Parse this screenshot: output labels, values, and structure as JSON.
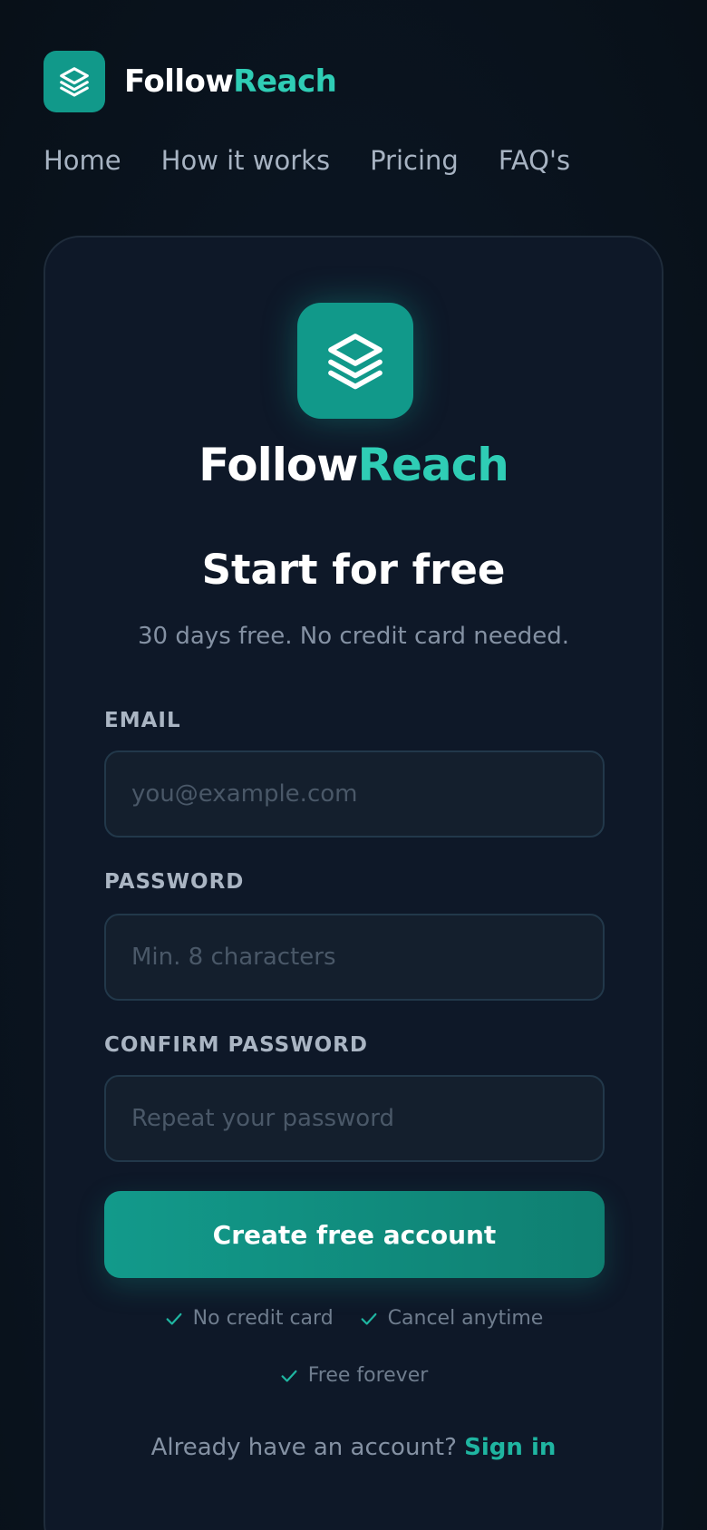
{
  "header": {
    "brand_part1": "Follow",
    "brand_part2": "Reach"
  },
  "nav": {
    "items": [
      {
        "label": "Home"
      },
      {
        "label": "How it works"
      },
      {
        "label": "Pricing"
      },
      {
        "label": "FAQ's"
      }
    ]
  },
  "card": {
    "brand_part1": "Follow",
    "brand_part2": "Reach",
    "title": "Start for free",
    "subtitle": "30 days free. No credit card needed."
  },
  "form": {
    "email_label": "EMAIL",
    "email_placeholder": "you@example.com",
    "email_value": "",
    "password_label": "PASSWORD",
    "password_placeholder": "Min. 8 characters",
    "password_value": "",
    "confirm_label": "CONFIRM PASSWORD",
    "confirm_placeholder": "Repeat your password",
    "confirm_value": "",
    "submit_label": "Create free account"
  },
  "perks": [
    {
      "label": "No credit card"
    },
    {
      "label": "Cancel anytime"
    },
    {
      "label": "Free forever"
    }
  ],
  "footer": {
    "prompt": "Already have an account?",
    "signin_label": "Sign in"
  },
  "icons": {
    "brand": "layers-icon",
    "perk": "check-icon"
  },
  "colors": {
    "accent": "#2fcdb5",
    "brand_tile": "#11998a",
    "background": "#0a1420",
    "card": "#0e1828"
  }
}
